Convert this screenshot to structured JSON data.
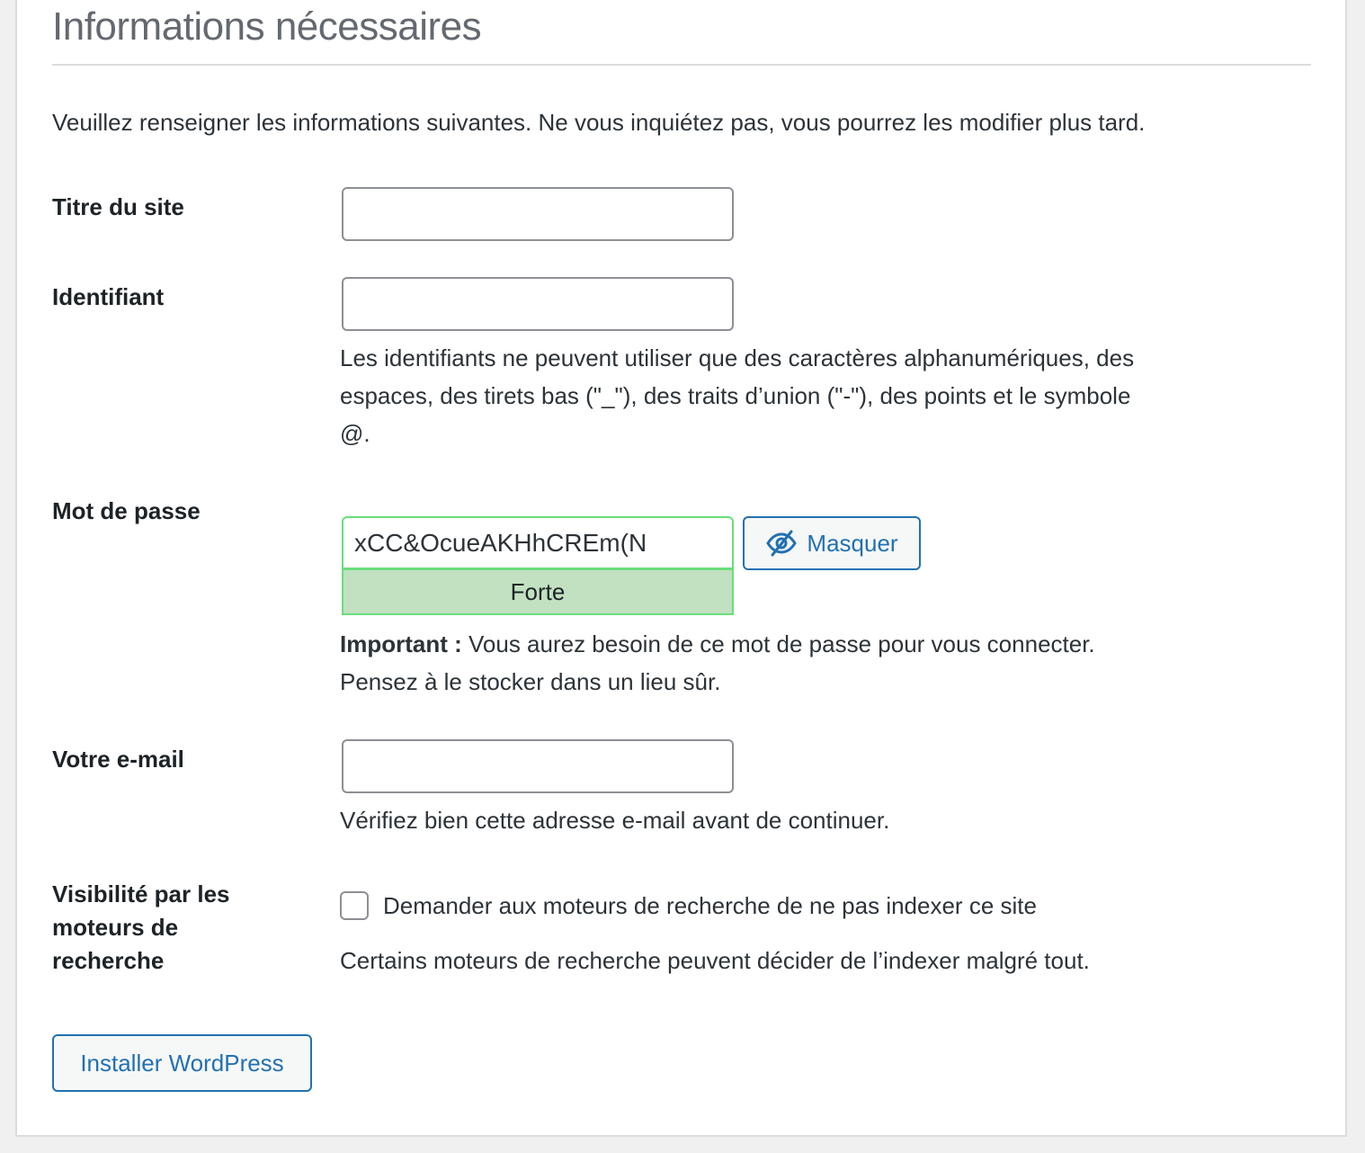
{
  "heading": "Informations nécessaires",
  "intro": "Veuillez renseigner les informations suivantes. Ne vous inquiétez pas, vous pourrez les modifier plus tard.",
  "site_title": {
    "label": "Titre du site",
    "value": ""
  },
  "username": {
    "label": "Identifiant",
    "value": "",
    "help_line1": "Les identifiants ne peuvent utiliser que des caractères alphanumériques, des",
    "help_line2": "espaces, des tirets bas (\"_\"), des traits d’union (\"-\"), des points et le symbole",
    "help_line3": "@."
  },
  "password": {
    "label": "Mot de passe",
    "value": "xCC&OcueAKHhCREm(N",
    "strength": "Forte",
    "toggle_label": "Masquer",
    "toggle_icon": "eye-slash-icon",
    "note_bold": "Important :",
    "note_rest": " Vous aurez besoin de ce mot de passe pour vous connecter.",
    "note_line2": "Pensez à le stocker dans un lieu sûr."
  },
  "email": {
    "label": "Votre e-mail",
    "value": "",
    "help": "Vérifiez bien cette adresse e-mail avant de continuer."
  },
  "visibility": {
    "label_line1": "Visibilité par les",
    "label_line2": "moteurs de",
    "label_line3": "recherche",
    "checkbox_label": "Demander aux moteurs de recherche de ne pas indexer ce site",
    "checked": false,
    "help": "Certains moteurs de recherche peuvent décider de l’indexer malgré tout."
  },
  "submit_label": "Installer WordPress",
  "colors": {
    "accent": "#2271b1",
    "strong_bg": "#c1e1c1",
    "strong_border": "#68de7c"
  }
}
